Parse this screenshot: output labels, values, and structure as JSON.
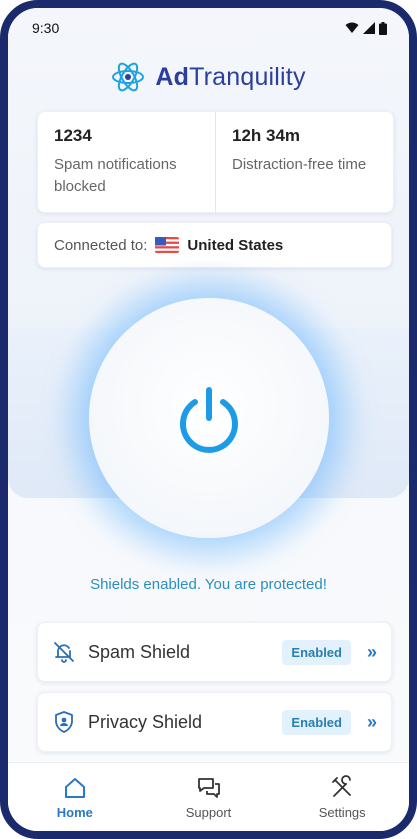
{
  "status_bar": {
    "time": "9:30"
  },
  "brand": {
    "name_bold": "Ad",
    "name_rest": "Tranquility",
    "icon": "atom-logo-icon"
  },
  "stats": [
    {
      "value": "1234",
      "label": "Spam notifications blocked"
    },
    {
      "value": "12h 34m",
      "label": "Distraction-free time"
    }
  ],
  "connection": {
    "prefix": "Connected to:",
    "country": "United States",
    "flag_icon": "us-flag-icon"
  },
  "power": {
    "icon": "power-icon",
    "accent": "#1e9be6"
  },
  "status_message": "Shields enabled. You are protected!",
  "shields": [
    {
      "label": "Spam Shield",
      "status": "Enabled",
      "icon": "bell-off-icon"
    },
    {
      "label": "Privacy Shield",
      "status": "Enabled",
      "icon": "privacy-shield-icon"
    }
  ],
  "nav": [
    {
      "label": "Home",
      "icon": "home-icon",
      "active": true
    },
    {
      "label": "Support",
      "icon": "chat-icon",
      "active": false
    },
    {
      "label": "Settings",
      "icon": "tools-icon",
      "active": false
    }
  ]
}
